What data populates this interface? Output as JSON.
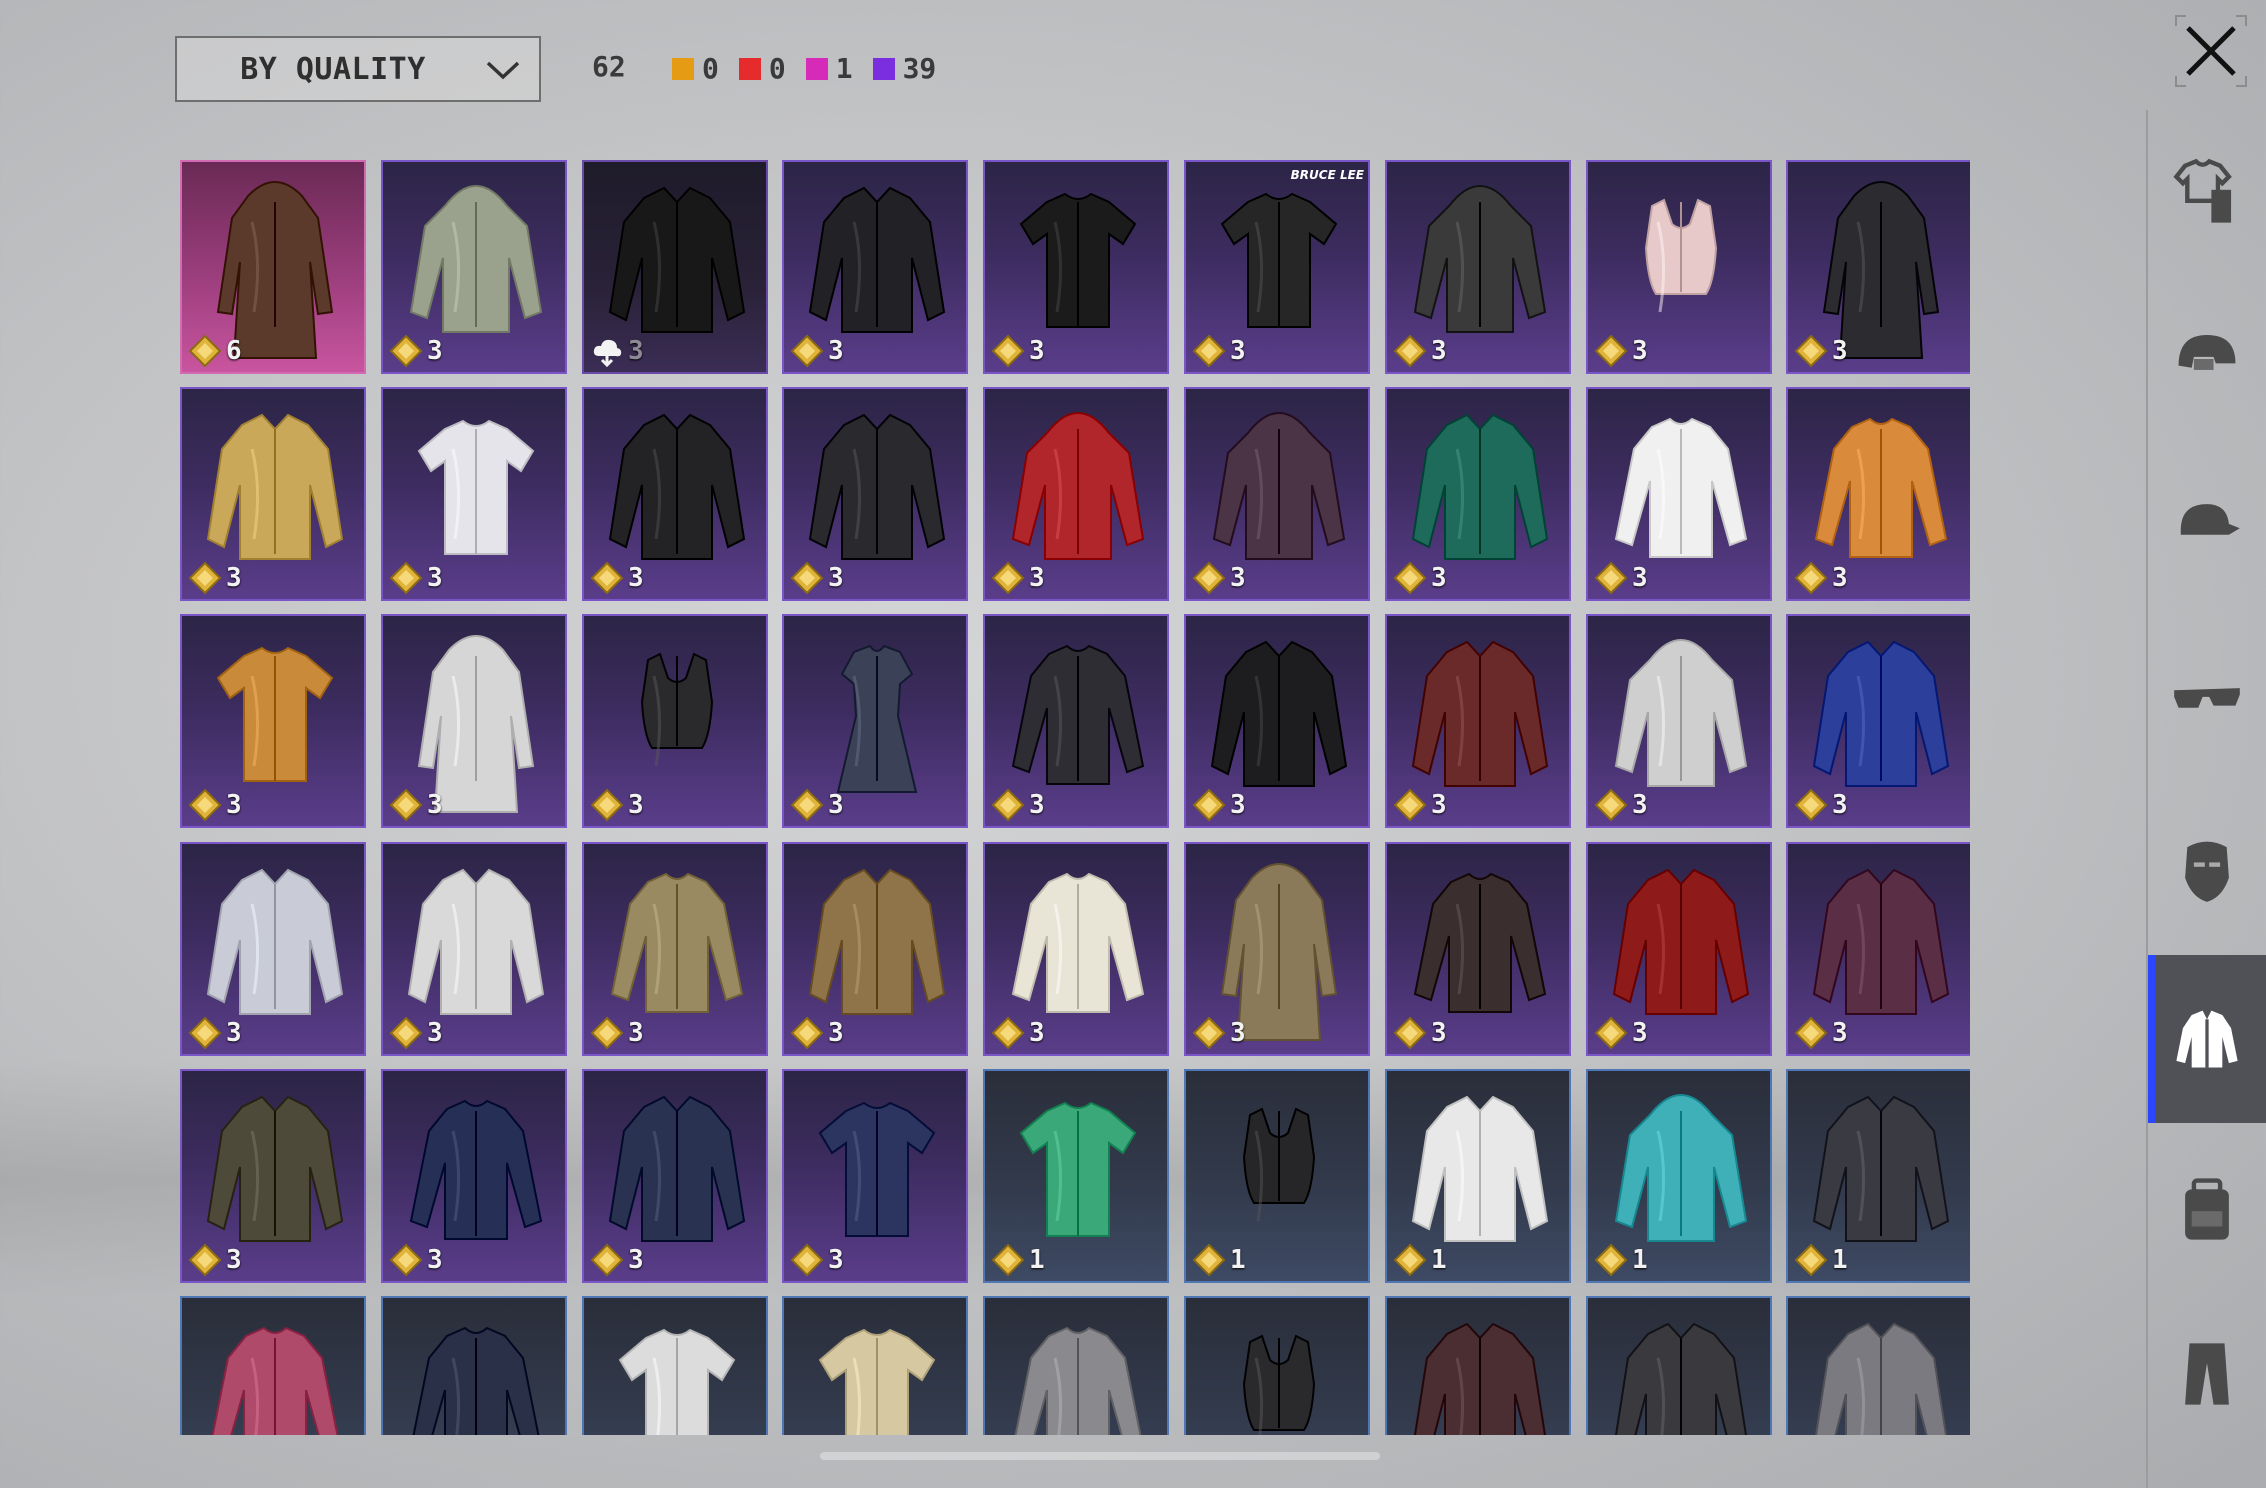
{
  "toolbar": {
    "sort_label": "BY QUALITY",
    "total_count": "62",
    "counters": [
      {
        "color": "#e59b14",
        "count": "0"
      },
      {
        "color": "#e52b2b",
        "count": "0"
      },
      {
        "color": "#d62ab8",
        "count": "1"
      },
      {
        "color": "#7a2ee0",
        "count": "39"
      }
    ]
  },
  "sidebar": {
    "categories": [
      {
        "icon": "outfit-set-icon",
        "active": false
      },
      {
        "icon": "helmet-icon",
        "active": false
      },
      {
        "icon": "cap-icon",
        "active": false
      },
      {
        "icon": "glasses-icon",
        "active": false
      },
      {
        "icon": "mask-icon",
        "active": false
      },
      {
        "icon": "jacket-icon",
        "active": true
      },
      {
        "icon": "backpack-icon",
        "active": false
      },
      {
        "icon": "pants-icon",
        "active": false
      }
    ]
  },
  "items": [
    {
      "rarity": "legend",
      "kind": "coat",
      "color": "#5b3a2c",
      "count": "6",
      "badge": "coin"
    },
    {
      "rarity": "epic",
      "kind": "hoodie",
      "color": "#9aa28e",
      "count": "3",
      "badge": "coin"
    },
    {
      "rarity": "epic-dark",
      "kind": "jacket",
      "color": "#181818",
      "count": "3",
      "badge": "cloud"
    },
    {
      "rarity": "epic",
      "kind": "jacket",
      "color": "#222226",
      "count": "3",
      "badge": "coin"
    },
    {
      "rarity": "epic",
      "kind": "tshirt",
      "color": "#1b1b1b",
      "count": "3",
      "badge": "coin"
    },
    {
      "rarity": "epic",
      "kind": "tshirt",
      "color": "#262626",
      "count": "3",
      "badge": "coin",
      "brand": "BRUCE LEE"
    },
    {
      "rarity": "epic",
      "kind": "hoodie",
      "color": "#3a3a3a",
      "count": "3",
      "badge": "coin"
    },
    {
      "rarity": "epic",
      "kind": "croptop",
      "color": "#e7c9c9",
      "count": "3",
      "badge": "coin"
    },
    {
      "rarity": "epic",
      "kind": "coat",
      "color": "#2c2c30",
      "count": "3",
      "badge": "coin"
    },
    {
      "rarity": "epic",
      "kind": "jacket",
      "color": "#c9a85a",
      "count": "3",
      "badge": "coin"
    },
    {
      "rarity": "epic",
      "kind": "tshirt",
      "color": "#e4e4ea",
      "count": "3",
      "badge": "coin"
    },
    {
      "rarity": "epic",
      "kind": "jacket",
      "color": "#232326",
      "count": "3",
      "badge": "coin"
    },
    {
      "rarity": "epic",
      "kind": "jacket",
      "color": "#2a2a2e",
      "count": "3",
      "badge": "coin"
    },
    {
      "rarity": "epic",
      "kind": "hoodie",
      "color": "#b1262a",
      "count": "3",
      "badge": "coin"
    },
    {
      "rarity": "epic",
      "kind": "hoodie",
      "color": "#4a3446",
      "count": "3",
      "badge": "coin"
    },
    {
      "rarity": "epic",
      "kind": "jacket",
      "color": "#1e6b5c",
      "count": "3",
      "badge": "coin"
    },
    {
      "rarity": "epic",
      "kind": "longsleeve",
      "color": "#f0f0f0",
      "count": "3",
      "badge": "coin"
    },
    {
      "rarity": "epic",
      "kind": "longsleeve",
      "color": "#d98a3a",
      "count": "3",
      "badge": "coin"
    },
    {
      "rarity": "epic",
      "kind": "tshirt",
      "color": "#c98a3a",
      "count": "3",
      "badge": "coin"
    },
    {
      "rarity": "epic",
      "kind": "coat",
      "color": "#d6d6d6",
      "count": "3",
      "badge": "coin"
    },
    {
      "rarity": "epic",
      "kind": "croptop",
      "color": "#2a2a2c",
      "count": "3",
      "badge": "coin"
    },
    {
      "rarity": "epic",
      "kind": "dress",
      "color": "#3b4258",
      "count": "3",
      "badge": "coin"
    },
    {
      "rarity": "epic",
      "kind": "longsleeve",
      "color": "#2d2d33",
      "count": "3",
      "badge": "coin"
    },
    {
      "rarity": "epic",
      "kind": "jacket",
      "color": "#1d1d1f",
      "count": "3",
      "badge": "coin"
    },
    {
      "rarity": "epic",
      "kind": "jacket",
      "color": "#6a2a2a",
      "count": "3",
      "badge": "coin"
    },
    {
      "rarity": "epic",
      "kind": "hoodie",
      "color": "#cfcfcf",
      "count": "3",
      "badge": "coin"
    },
    {
      "rarity": "epic",
      "kind": "jacket",
      "color": "#2c3f9a",
      "count": "3",
      "badge": "coin"
    },
    {
      "rarity": "epic",
      "kind": "jacket",
      "color": "#c9ccd6",
      "count": "3",
      "badge": "coin"
    },
    {
      "rarity": "epic",
      "kind": "jacket",
      "color": "#d9d9d9",
      "count": "3",
      "badge": "coin"
    },
    {
      "rarity": "epic",
      "kind": "longsleeve",
      "color": "#9a8a62",
      "count": "3",
      "badge": "coin"
    },
    {
      "rarity": "epic",
      "kind": "jacket",
      "color": "#8e7448",
      "count": "3",
      "badge": "coin"
    },
    {
      "rarity": "epic",
      "kind": "longsleeve",
      "color": "#e8e4d6",
      "count": "3",
      "badge": "coin"
    },
    {
      "rarity": "epic",
      "kind": "coat",
      "color": "#8a7a5a",
      "count": "3",
      "badge": "coin"
    },
    {
      "rarity": "epic",
      "kind": "longsleeve",
      "color": "#3a2e2e",
      "count": "3",
      "badge": "coin"
    },
    {
      "rarity": "epic",
      "kind": "jacket",
      "color": "#8e1a1a",
      "count": "3",
      "badge": "coin"
    },
    {
      "rarity": "epic",
      "kind": "jacket",
      "color": "#5a2e44",
      "count": "3",
      "badge": "coin"
    },
    {
      "rarity": "epic",
      "kind": "jacket",
      "color": "#4e4a3a",
      "count": "3",
      "badge": "coin"
    },
    {
      "rarity": "epic",
      "kind": "longsleeve",
      "color": "#263056",
      "count": "3",
      "badge": "coin"
    },
    {
      "rarity": "epic",
      "kind": "jacket",
      "color": "#2a3252",
      "count": "3",
      "badge": "coin"
    },
    {
      "rarity": "epic",
      "kind": "tshirt",
      "color": "#2c3560",
      "count": "3",
      "badge": "coin"
    },
    {
      "rarity": "rare",
      "kind": "tshirt",
      "color": "#3aa878",
      "count": "1",
      "badge": "coin"
    },
    {
      "rarity": "rare",
      "kind": "croptop",
      "color": "#262628",
      "count": "1",
      "badge": "coin"
    },
    {
      "rarity": "rare",
      "kind": "jacket",
      "color": "#e8e8e8",
      "count": "1",
      "badge": "coin"
    },
    {
      "rarity": "rare",
      "kind": "hoodie",
      "color": "#3fb0b8",
      "count": "1",
      "badge": "coin"
    },
    {
      "rarity": "rare",
      "kind": "jacket",
      "color": "#3a3a42",
      "count": "1",
      "badge": "coin"
    },
    {
      "rarity": "rare",
      "kind": "longsleeve",
      "color": "#b04a6a",
      "count": "",
      "badge": "none"
    },
    {
      "rarity": "rare",
      "kind": "longsleeve",
      "color": "#2a3048",
      "count": "",
      "badge": "none"
    },
    {
      "rarity": "rare",
      "kind": "tshirt",
      "color": "#dcdcdc",
      "count": "",
      "badge": "none"
    },
    {
      "rarity": "rare",
      "kind": "tshirt",
      "color": "#d6c9a2",
      "count": "",
      "badge": "none"
    },
    {
      "rarity": "rare",
      "kind": "longsleeve",
      "color": "#8a8a8e",
      "count": "",
      "badge": "none"
    },
    {
      "rarity": "rare",
      "kind": "croptop",
      "color": "#2a2a2c",
      "count": "",
      "badge": "none"
    },
    {
      "rarity": "rare",
      "kind": "jacket",
      "color": "#4a2e32",
      "count": "",
      "badge": "none"
    },
    {
      "rarity": "rare",
      "kind": "jacket",
      "color": "#3a3a3e",
      "count": "",
      "badge": "none"
    },
    {
      "rarity": "rare",
      "kind": "jacket",
      "color": "#7a7a80",
      "count": "",
      "badge": "none"
    }
  ]
}
